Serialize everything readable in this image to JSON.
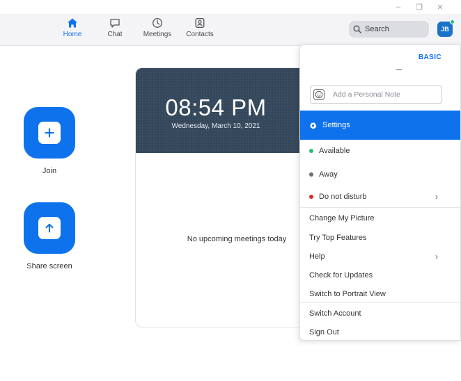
{
  "window": {
    "controls": {
      "minimize_icon": "–",
      "restore_icon": "❐",
      "close_icon": "✕"
    }
  },
  "nav": {
    "tabs": [
      {
        "label": "Home",
        "icon": "home-icon",
        "active": true
      },
      {
        "label": "Chat",
        "icon": "chat-icon",
        "active": false
      },
      {
        "label": "Meetings",
        "icon": "clock-icon",
        "active": false
      },
      {
        "label": "Contacts",
        "icon": "contacts-icon",
        "active": false
      }
    ],
    "search_label": "Search",
    "avatar_initials": "JB",
    "accent_color": "#0e72ed",
    "presence_color": "#23c16b"
  },
  "actions": [
    {
      "label": "Join",
      "icon": "plus-icon"
    },
    {
      "label": "Share screen",
      "icon": "arrow-up-icon"
    }
  ],
  "meetings_panel": {
    "time": "08:54 PM",
    "date": "Wednesday, March 10, 2021",
    "empty_text": "No upcoming meetings today"
  },
  "profile_menu": {
    "plan": "BASIC",
    "note_placeholder": "Add a Personal Note",
    "settings_label": "Settings",
    "status_items": [
      {
        "label": "Available",
        "color": "#23c16b"
      },
      {
        "label": "Away",
        "color": "#6b6f76"
      },
      {
        "label": "Do not disturb",
        "color": "#e02828",
        "has_submenu": true
      }
    ],
    "items": [
      {
        "label": "Change My Picture"
      },
      {
        "label": "Try Top Features"
      },
      {
        "label": "Help",
        "has_submenu": true
      },
      {
        "label": "Check for Updates"
      },
      {
        "label": "Switch to Portrait View"
      },
      {
        "label": "Switch Account"
      },
      {
        "label": "Sign Out"
      }
    ]
  }
}
